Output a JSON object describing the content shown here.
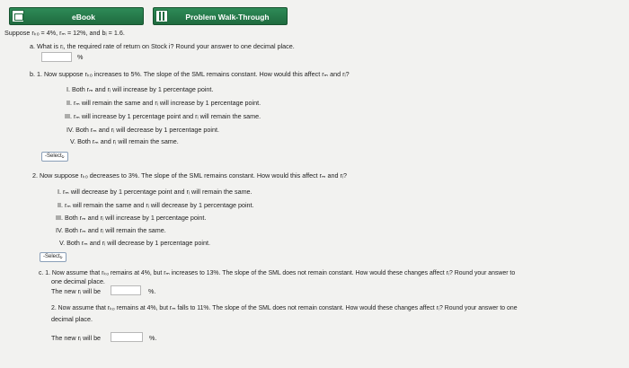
{
  "tabs": {
    "ebook": "eBook",
    "walkthrough": "Problem Walk-Through"
  },
  "intro": "Suppose rₖₒ = 4%, rₘ = 12%, and bᵢ = 1.6.",
  "qa": {
    "prompt": "a. What is rᵢ, the required rate of return on Stock i? Round your answer to one decimal place.",
    "unit": "%"
  },
  "qb1": {
    "prompt": "b. 1. Now suppose rₖₒ increases to 5%. The slope of the SML remains constant. How would this affect rₘ and rᵢ?",
    "options": [
      "I. Both rₘ and rᵢ will increase by 1 percentage point.",
      "II. rₘ will remain the same and rᵢ will increase by 1 percentage point.",
      "III. rₘ will increase by 1 percentage point and rᵢ will remain the same.",
      "IV. Both rₘ and rᵢ will decrease by 1 percentage point.",
      "V. Both rₘ and rᵢ will remain the same."
    ],
    "select": "-Select-"
  },
  "qb2": {
    "prompt": "2. Now suppose rₖₒ decreases to 3%. The slope of the SML remains constant. How would this affect rₘ and rᵢ?",
    "options": [
      "I. rₘ will decrease by 1 percentage point and rᵢ will remain the same.",
      "II. rₘ will remain the same and rᵢ will decrease by 1 percentage point.",
      "III. Both rₘ and rᵢ will increase by 1 percentage point.",
      "IV. Both rₘ and rᵢ will remain the same.",
      "V. Both rₘ and rᵢ will decrease by 1 percentage point."
    ],
    "select": "-Select-"
  },
  "qc1": {
    "prompt_l1": "c. 1. Now assume that rₖₒ remains at 4%, but rₘ increases to 13%. The slope of the SML does not remain constant. How would these changes affect rᵢ? Round your answer to",
    "prompt_l2": "one decimal place.",
    "answer_label": "The new rᵢ will be",
    "unit": "%."
  },
  "qc2": {
    "prompt_l1": "2. Now assume that rₖₒ remains at 4%, but rₘ falls to 11%. The slope of the SML does not remain constant. How would these changes affect rᵢ? Round your answer to one",
    "prompt_l2": "decimal place.",
    "answer_label": "The new rᵢ will be",
    "unit": "%."
  }
}
